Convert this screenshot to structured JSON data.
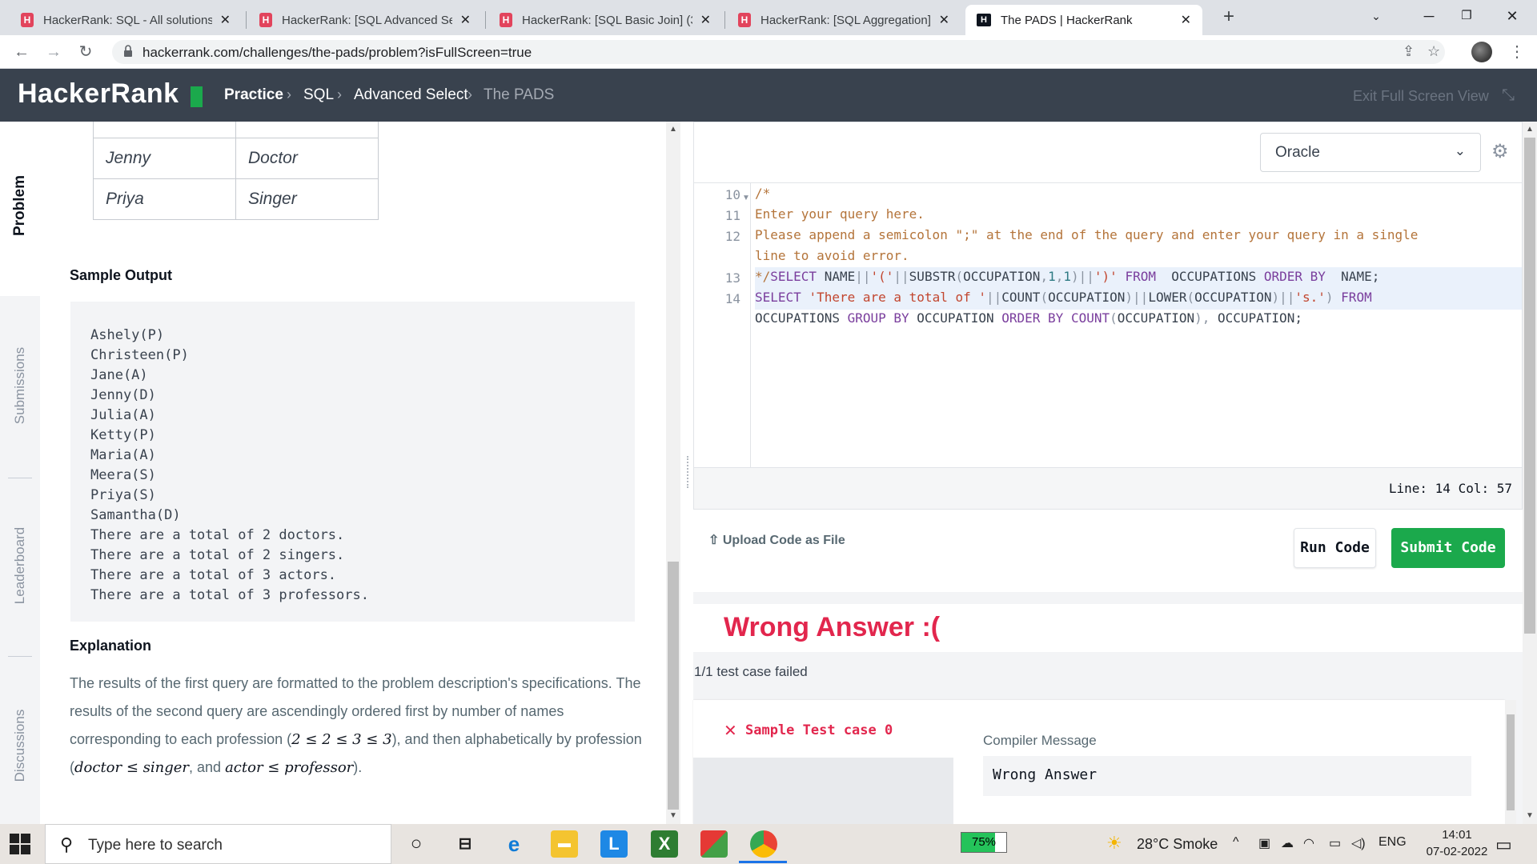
{
  "browser": {
    "tabs": [
      {
        "title": "HackerRank: SQL - All solutions (",
        "active": false
      },
      {
        "title": "HackerRank: [SQL Advanced Sele",
        "active": false
      },
      {
        "title": "HackerRank: [SQL Basic Join] (3/8",
        "active": false
      },
      {
        "title": "HackerRank: [SQL Aggregation] (",
        "active": false
      },
      {
        "title": "The PADS | HackerRank",
        "active": true
      }
    ],
    "url": "hackerrank.com/challenges/the-pads/problem?isFullScreen=true"
  },
  "header": {
    "logo": "HackerRank",
    "breadcrumb": [
      "Practice",
      "SQL",
      "Advanced Select",
      "The PADS"
    ],
    "exit_fullscreen": "Exit Full Screen View"
  },
  "side_tabs": [
    "Problem",
    "Submissions",
    "Leaderboard",
    "Discussions"
  ],
  "problem": {
    "sample_table_rows": [
      [
        "Jenny",
        "Doctor"
      ],
      [
        "Priya",
        "Singer"
      ]
    ],
    "sample_output_title": "Sample Output",
    "sample_output": [
      "Ashely(P)",
      "Christeen(P)",
      "Jane(A)",
      "Jenny(D)",
      "Julia(A)",
      "Ketty(P)",
      "Maria(A)",
      "Meera(S)",
      "Priya(S)",
      "Samantha(D)",
      "There are a total of 2 doctors.",
      "There are a total of 2 singers.",
      "There are a total of 3 actors.",
      "There are a total of 3 professors."
    ],
    "explanation_title": "Explanation",
    "explanation": {
      "p1": "The results of the first query are formatted to the problem description's specifications.",
      "p2_start": "The results of the second query are ascendingly ordered first by number of names corresponding to each profession (",
      "p2_math1": "2 ≤ 2 ≤ 3 ≤ 3",
      "p2_mid": "), and then alphabetically by profession (",
      "p2_math2": "doctor ≤ singer",
      "p2_and": ", and ",
      "p2_math3": "actor ≤ professor",
      "p2_end": ")."
    }
  },
  "editor": {
    "language": "Oracle",
    "line_numbers": [
      "10",
      "11",
      "12",
      "",
      "13",
      "14",
      ""
    ],
    "status": "Line: 14 Col: 57"
  },
  "actions": {
    "upload": "Upload Code as File",
    "run": "Run Code",
    "submit": "Submit Code"
  },
  "result": {
    "title": "Wrong Answer :(",
    "summary": "1/1 test case failed",
    "test_case": "Sample Test case 0",
    "compiler_label": "Compiler Message",
    "compiler_message": "Wrong Answer"
  },
  "taskbar": {
    "search_placeholder": "Type here to search",
    "battery": "75%",
    "weather": "28°C  Smoke",
    "language": "ENG",
    "time": "14:01",
    "date": "07-02-2022"
  }
}
